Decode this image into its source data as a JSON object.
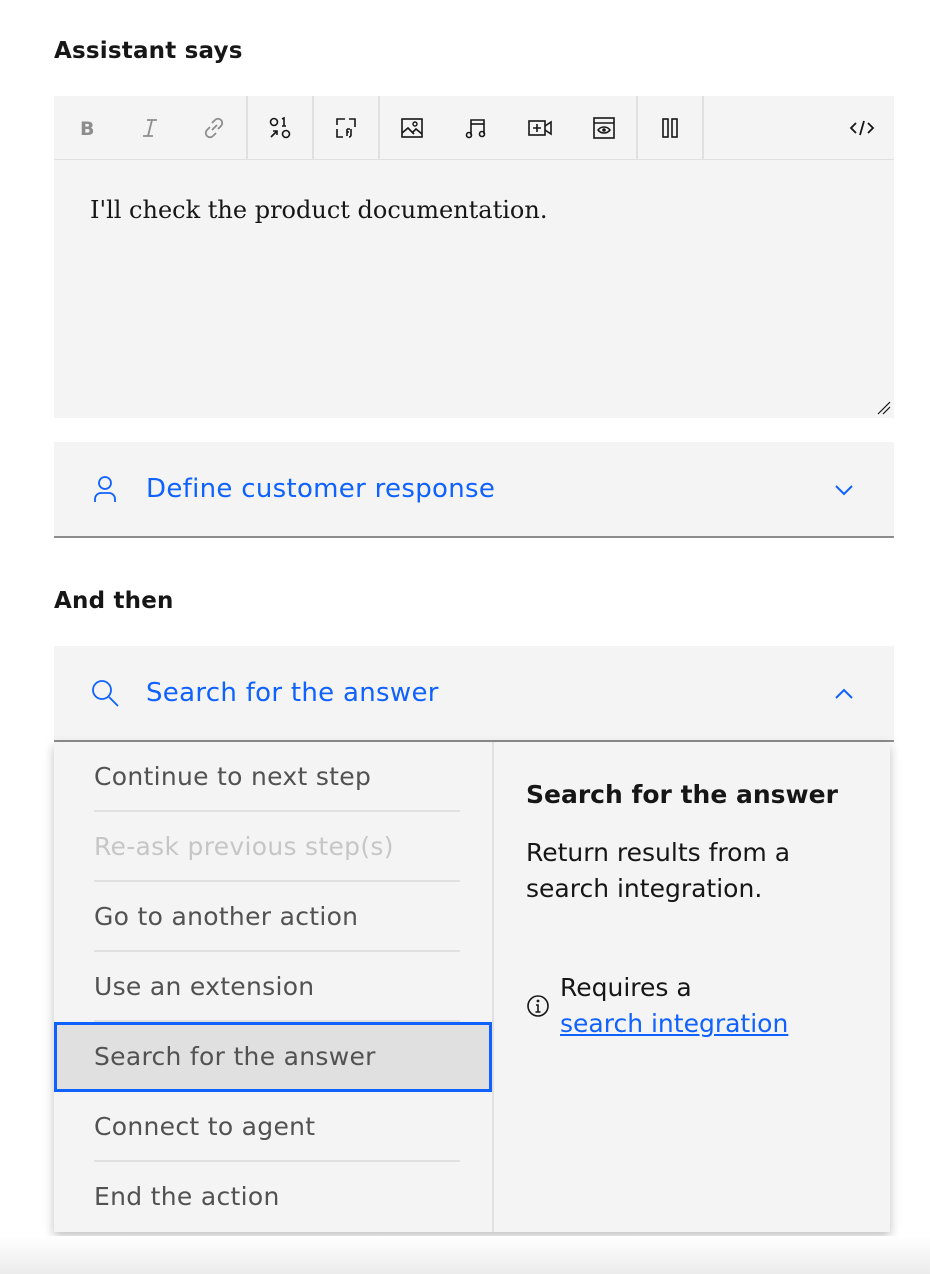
{
  "assistant_says": {
    "heading": "Assistant says"
  },
  "editor": {
    "toolbar": {
      "buttons": [
        {
          "name": "bold",
          "icon": "bold-icon"
        },
        {
          "name": "italic",
          "icon": "italic-icon"
        },
        {
          "name": "link",
          "icon": "link-icon"
        },
        {
          "name": "options",
          "icon": "options-icon"
        },
        {
          "name": "variables",
          "icon": "variables-icon"
        },
        {
          "name": "image",
          "icon": "image-icon"
        },
        {
          "name": "audio",
          "icon": "audio-icon"
        },
        {
          "name": "video",
          "icon": "video-icon"
        },
        {
          "name": "iframe",
          "icon": "iframe-icon"
        },
        {
          "name": "pause",
          "icon": "pause-icon"
        },
        {
          "name": "code",
          "icon": "code-icon"
        }
      ]
    },
    "text": "I'll check the product documentation."
  },
  "customer_response": {
    "label": "Define customer response",
    "icon": "user-icon",
    "expanded": false
  },
  "and_then": {
    "heading": "And then",
    "selected_label": "Search for the answer",
    "icon": "search-icon",
    "expanded": true
  },
  "menu": {
    "items": [
      {
        "label": "Continue to next step",
        "disabled": false,
        "selected": false
      },
      {
        "label": "Re-ask previous step(s)",
        "disabled": true,
        "selected": false
      },
      {
        "label": "Go to another action",
        "disabled": false,
        "selected": false
      },
      {
        "label": "Use an extension",
        "disabled": false,
        "selected": false
      },
      {
        "label": "Search for the answer",
        "disabled": false,
        "selected": true
      },
      {
        "label": "Connect to agent",
        "disabled": false,
        "selected": false
      },
      {
        "label": "End the action",
        "disabled": false,
        "selected": false
      }
    ]
  },
  "detail": {
    "title": "Search for the answer",
    "description": "Return results from a search integration.",
    "note_prefix": "Requires a",
    "note_link": "search integration"
  },
  "colors": {
    "accent": "#0f62fe",
    "surface": "#f4f4f4",
    "text": "#161616",
    "disabled": "#c6c6c6"
  }
}
